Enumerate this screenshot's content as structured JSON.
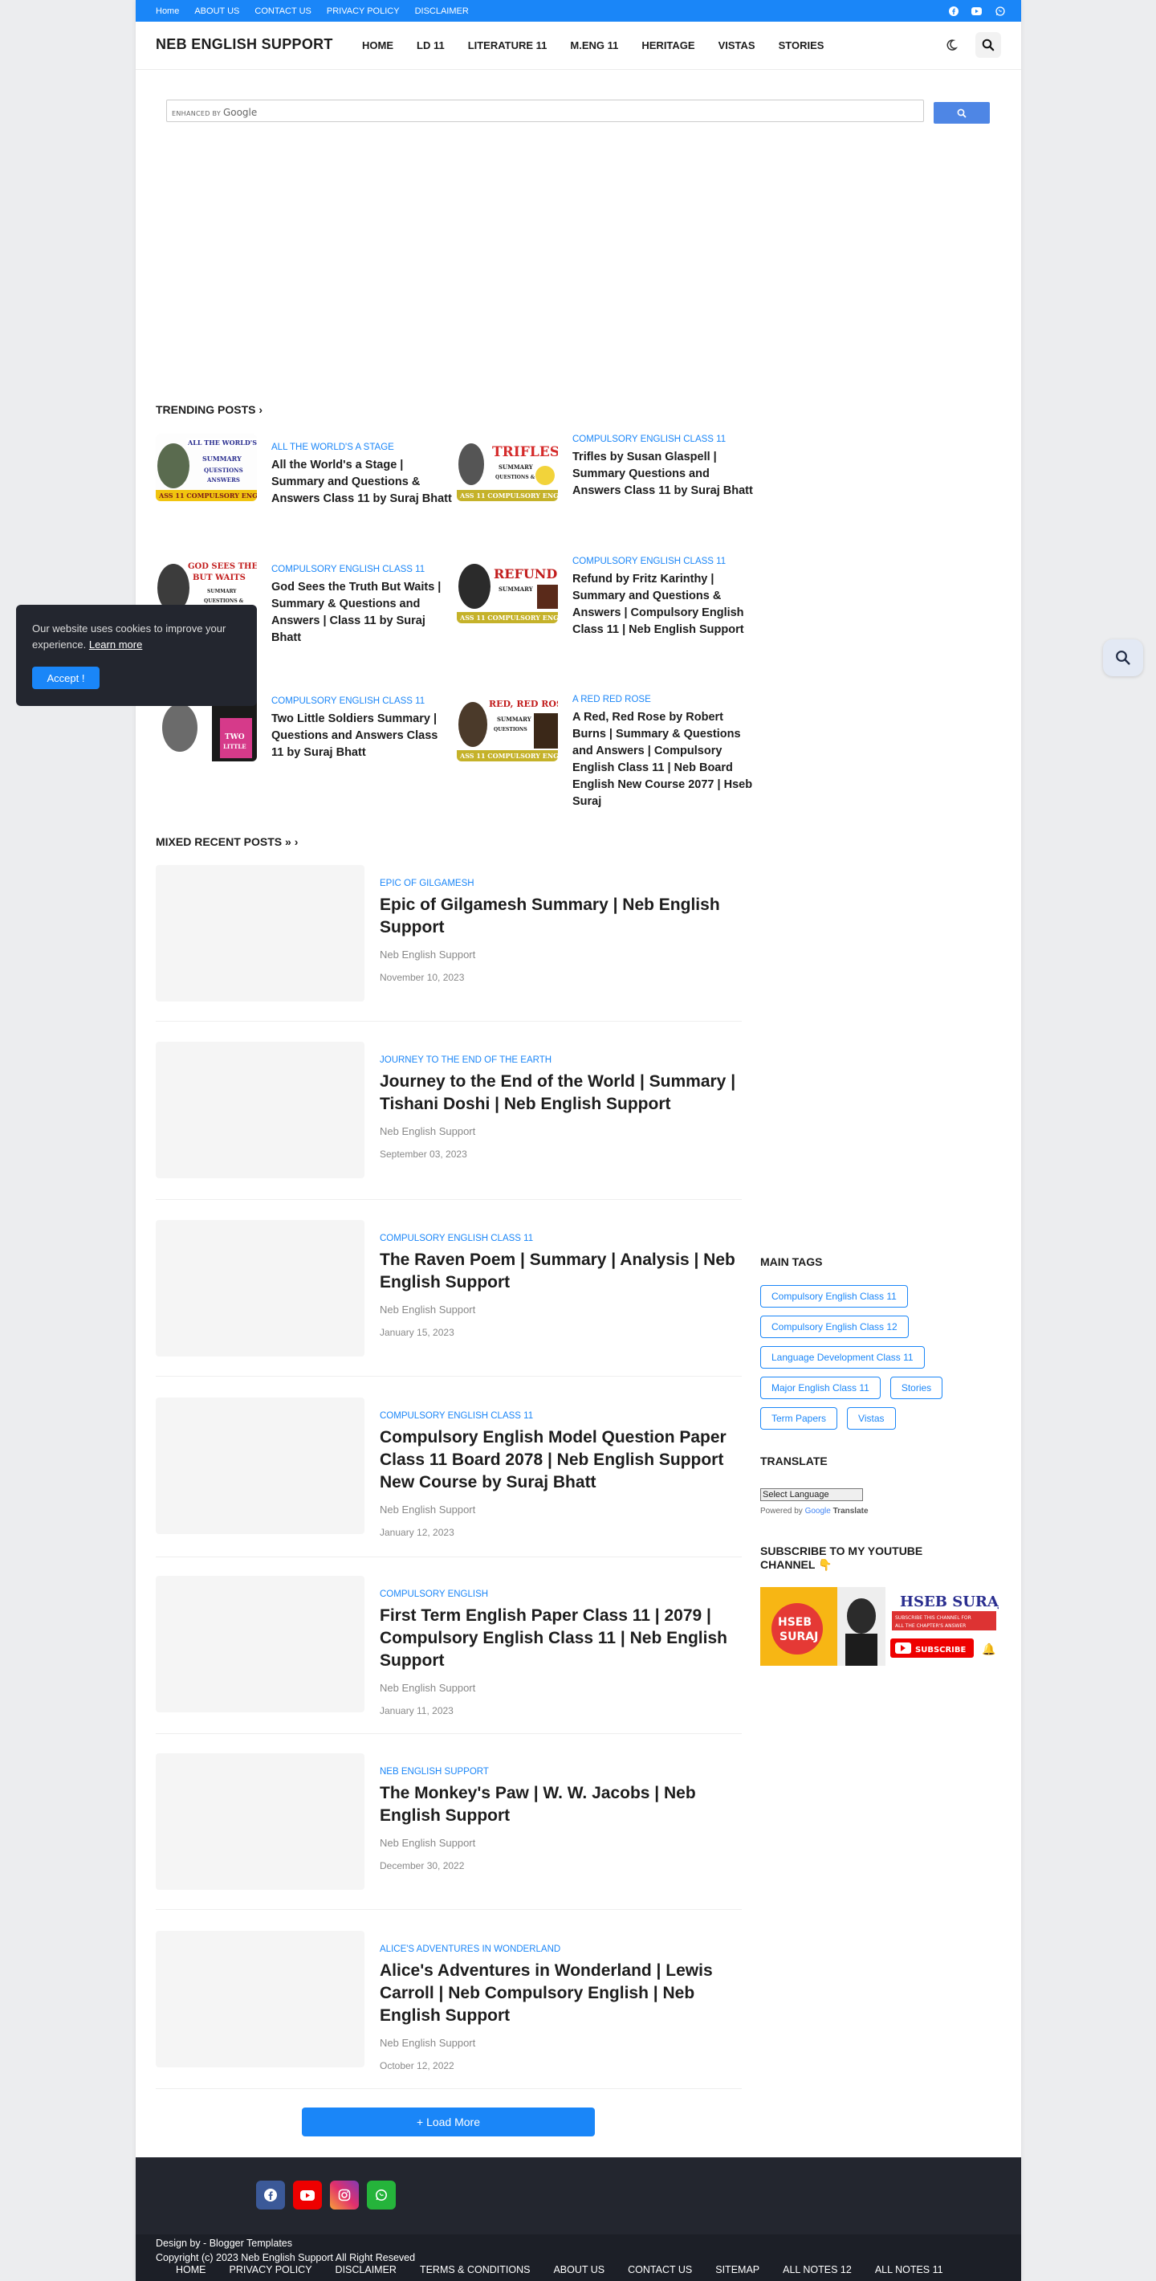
{
  "colors": {
    "accent": "#1a86f8",
    "footer_bg": "#23262f"
  },
  "topbar": {
    "links": [
      "Home",
      "ABOUT US",
      "CONTACT US",
      "PRIVACY POLICY",
      "DISCLAIMER"
    ],
    "social_icons": [
      "facebook-icon",
      "youtube-icon",
      "whatsapp-icon"
    ]
  },
  "header": {
    "logo": "NEB ENGLISH SUPPORT",
    "nav": [
      "HOME",
      "LD 11",
      "LITERATURE 11",
      "M.ENG 11",
      "HERITAGE",
      "VISTAS",
      "STORIES"
    ],
    "icons": [
      "moon-icon",
      "search-icon"
    ]
  },
  "search": {
    "enhanced_by": "ENHANCED BY",
    "brand": "Google",
    "button_icon": "search-icon"
  },
  "trending": {
    "title": "TRENDING POSTS",
    "items": [
      {
        "category": "ALL THE WORLD'S A STAGE",
        "title": "All the World's a Stage | Summary and Questions & Answers Class 11 by Suraj Bhatt",
        "thumb_text": "ALL THE WORLD'S A STAGE"
      },
      {
        "category": "COMPULSORY ENGLISH CLASS 11",
        "title": "Trifles by Susan Glaspell | Summary Questions and Answers Class 11 by Suraj Bhatt",
        "thumb_text": "TRIFLES"
      },
      {
        "category": "COMPULSORY ENGLISH CLASS 11",
        "title": "God Sees the Truth But Waits | Summary & Questions and Answers | Class 11 by Suraj Bhatt",
        "thumb_text": "GOD SEES THE TRUTH BUT WAITS"
      },
      {
        "category": "COMPULSORY ENGLISH CLASS 11",
        "title": "Refund by Fritz Karinthy | Summary and Questions & Answers | Compulsory English Class 11 | Neb English Support",
        "thumb_text": "REFUND"
      },
      {
        "category": "COMPULSORY ENGLISH CLASS 11",
        "title": "Two Little Soldiers Summary | Questions and Answers Class 11 by Suraj Bhatt",
        "thumb_text": "TWO LITTLE SOLDIERS"
      },
      {
        "category": "A RED RED ROSE",
        "title": "A Red, Red Rose by Robert Burns | Summary & Questions and Answers | Compulsory English Class 11 | Neb Board English New Course 2077 | Hseb Suraj",
        "thumb_text": "RED, RED ROSE"
      }
    ]
  },
  "recent": {
    "title": "MIXED RECENT POSTS »",
    "posts": [
      {
        "category": "EPIC OF GILGAMESH",
        "title": "Epic of Gilgamesh Summary | Neb English Support",
        "author": "Neb English Support",
        "date": "November 10, 2023"
      },
      {
        "category": "JOURNEY TO THE END OF THE EARTH",
        "title": "Journey to the End of the World | Summary | Tishani Doshi | Neb English Support",
        "author": "Neb English Support",
        "date": "September 03, 2023"
      },
      {
        "category": "COMPULSORY ENGLISH CLASS 11",
        "title": "The Raven Poem | Summary | Analysis | Neb English Support",
        "author": "Neb English Support",
        "date": "January 15, 2023"
      },
      {
        "category": "COMPULSORY ENGLISH CLASS 11",
        "title": "Compulsory English Model Question Paper Class 11 Board 2078 | Neb English Support New Course by Suraj Bhatt",
        "author": "Neb English Support",
        "date": "January 12, 2023"
      },
      {
        "category": "COMPULSORY ENGLISH",
        "title": "First Term English Paper Class 11 | 2079 | Compulsory English Class 11 | Neb English Support",
        "author": "Neb English Support",
        "date": "January 11, 2023"
      },
      {
        "category": "NEB ENGLISH SUPPORT",
        "title": "The Monkey's Paw | W. W. Jacobs | Neb English Support",
        "author": "Neb English Support",
        "date": "December 30, 2022"
      },
      {
        "category": "ALICE'S ADVENTURES IN WONDERLAND",
        "title": "Alice's Adventures in Wonderland | Lewis Carroll | Neb Compulsory English | Neb English Support",
        "author": "Neb English Support",
        "date": "October 12, 2022"
      }
    ],
    "load_more": "+ Load More"
  },
  "sidebar": {
    "tags_title": "MAIN TAGS",
    "tags": [
      "Compulsory English Class 11",
      "Compulsory English Class 12",
      "Language Development Class 11",
      "Major English Class 11",
      "Stories",
      "Term Papers",
      "Vistas"
    ],
    "translate_title": "TRANSLATE",
    "translate_select": "Select Language",
    "powered_by": "Powered by",
    "powered_google": "Google",
    "powered_translate": "Translate",
    "youtube_title": "SUBSCRIBE TO MY YOUTUBE CHANNEL 👇",
    "yt_banner": {
      "name": "HSEB SURAJ",
      "tagline": "SUBSCRIBE THIS CHANNEL FOR ALL THE CHAPTER'S ANSWER",
      "subscribe": "SUBSCRIBE"
    }
  },
  "footer": {
    "social_icons": [
      "facebook-icon",
      "youtube-icon",
      "instagram-icon",
      "whatsapp-icon"
    ],
    "design_by": "Design by - Blogger Templates",
    "copyright": "Copyright (c) 2023 Neb English Support All Right Reseved",
    "links": [
      "HOME",
      "PRIVACY POLICY",
      "DISCLAIMER",
      "TERMS & CONDITIONS",
      "ABOUT US",
      "CONTACT US",
      "SITEMAP",
      "ALL NOTES 12",
      "ALL NOTES 11"
    ]
  },
  "cookie": {
    "text": "Our website uses cookies to improve your experience.",
    "learn_more": "Learn more",
    "accept": "Accept !"
  }
}
